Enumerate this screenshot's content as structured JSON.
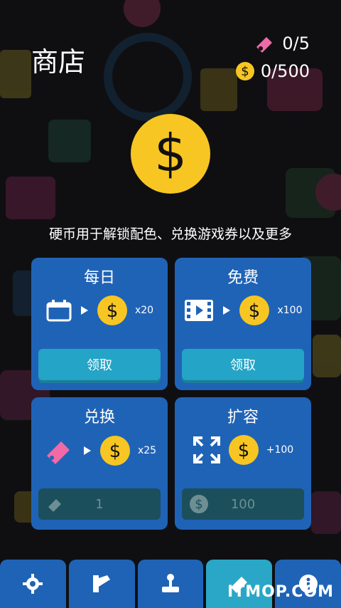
{
  "header": {
    "title": "商店",
    "tickets": "0/5",
    "coins": "0/500"
  },
  "description": "硬币用于解锁配色、兑换游戏券以及更多",
  "cards": {
    "daily": {
      "title": "每日",
      "multiplier": "x20",
      "button": "领取"
    },
    "free": {
      "title": "免费",
      "multiplier": "x100",
      "button": "领取"
    },
    "exchange": {
      "title": "兑换",
      "multiplier": "x25",
      "button_value": "1"
    },
    "expand": {
      "title": "扩容",
      "multiplier": "+100",
      "button_value": "100"
    }
  },
  "nav": {
    "items": [
      "settings-icon",
      "palette-icon",
      "joystick-icon",
      "shop-ticket-icon",
      "info-icon"
    ]
  },
  "watermark": "ITMOP.COM",
  "colors": {
    "card_blue": "#1f63b6",
    "button_teal": "#24a4c6",
    "coin_yellow": "#f7c623",
    "ticket_pink": "#ef6aa6"
  }
}
